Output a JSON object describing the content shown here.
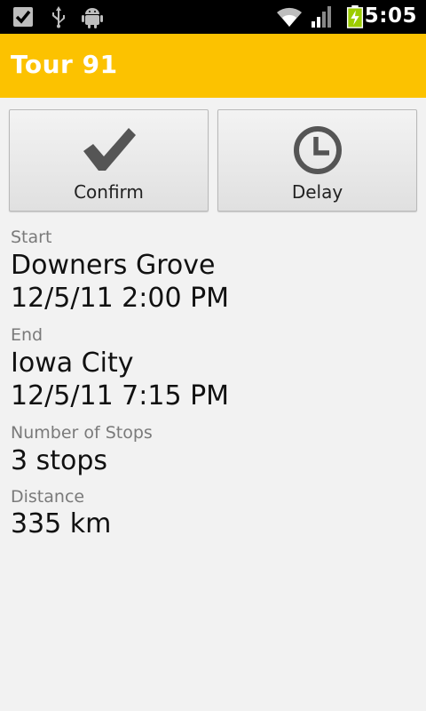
{
  "status_bar": {
    "time": "5:05",
    "icons": [
      "checkbox-icon",
      "usb-icon",
      "android-debug-icon",
      "wifi-icon",
      "signal-icon",
      "battery-charging-icon"
    ]
  },
  "title_bar": {
    "title": "Tour 91",
    "color": "#fcc200"
  },
  "actions": {
    "confirm_label": "Confirm",
    "confirm_icon": "checkmark-icon",
    "delay_label": "Delay",
    "delay_icon": "clock-icon"
  },
  "details": {
    "start": {
      "label": "Start",
      "place": "Downers Grove",
      "datetime": "12/5/11 2:00 PM"
    },
    "end": {
      "label": "End",
      "place": "Iowa City",
      "datetime": "12/5/11 7:15 PM"
    },
    "stops": {
      "label": "Number of Stops",
      "value": "3 stops"
    },
    "distance": {
      "label": "Distance",
      "value": "335 km"
    }
  }
}
